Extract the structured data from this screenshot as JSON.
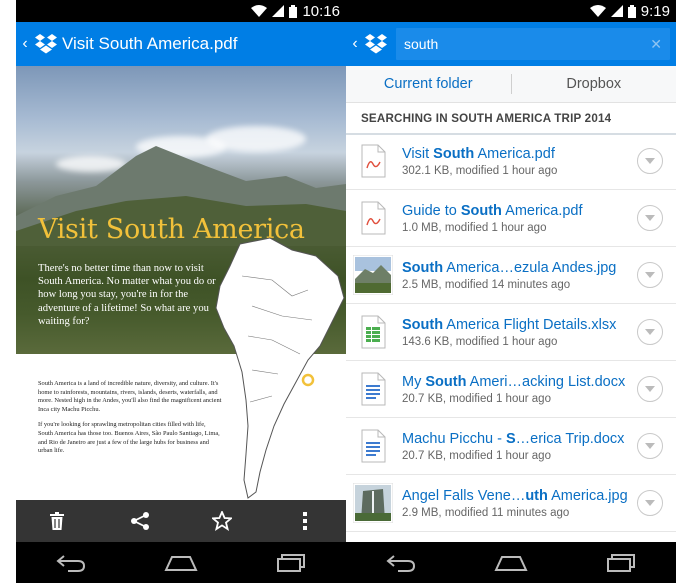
{
  "left": {
    "status_time": "10:16",
    "title": "Visit South America.pdf",
    "doc": {
      "title": "Visit South America",
      "intro": "There's no better time than now to visit South America. No matter what you do or how long you stay, you're in for the adventure of a lifetime! So what are you waiting for?",
      "para1": "South America is a land of incredible nature, diversity, and culture. It's home to rainforests, mountains, rivers, islands, deserts, waterfalls, and more. Nested high in the Andes, you'll also find the magnificent ancient Inca city Machu Picchu.",
      "para2": "If you're looking for sprawling metropolitan cities filled with life, South America has those too. Buenos Aires, São Paulo Santiago, Lima, and Rio de Janeiro are just a few of the large hubs for business and urban life."
    },
    "toolbar": [
      "trash-icon",
      "share-icon",
      "star-icon",
      "overflow-icon"
    ]
  },
  "right": {
    "status_time": "9:19",
    "search_query": "south",
    "tabs": {
      "current": "Current folder",
      "dropbox": "Dropbox"
    },
    "section_header": "SEARCHING IN SOUTH AMERICA TRIP 2014",
    "results": [
      {
        "pre": "Visit ",
        "match": "South",
        "post": " America.pdf",
        "meta": "302.1 KB, modified 1 hour ago",
        "icon": "pdf-icon"
      },
      {
        "pre": "Guide to ",
        "match": "South",
        "post": " America.pdf",
        "meta": "1.0 MB, modified 1 hour ago",
        "icon": "pdf-icon"
      },
      {
        "pre": "",
        "match": "South",
        "post": " America…ezula Andes.jpg",
        "meta": "2.5 MB, modified 14 minutes ago",
        "icon": "image-thumbnail-andes"
      },
      {
        "pre": "",
        "match": "South",
        "post": " America Flight Details.xlsx",
        "meta": "143.6 KB, modified 1 hour ago",
        "icon": "spreadsheet-icon"
      },
      {
        "pre": "My ",
        "match": "South",
        "post": " Ameri…acking List.docx",
        "meta": "20.7 KB, modified 1 hour ago",
        "icon": "document-icon"
      },
      {
        "pre": "Machu Picchu - ",
        "match": "S",
        "post": "…erica Trip.docx",
        "meta": "20.7 KB, modified 1 hour ago",
        "icon": "document-icon"
      },
      {
        "pre": "Angel Falls Vene…",
        "match": "uth",
        "post": " America.jpg",
        "meta": "2.9 MB, modified 11 minutes ago",
        "icon": "image-thumbnail-angel-falls"
      }
    ]
  },
  "colors": {
    "dropbox_blue": "#007ee5",
    "link_blue": "#0a6fc4",
    "doc_title_gold": "#f2c13a"
  }
}
